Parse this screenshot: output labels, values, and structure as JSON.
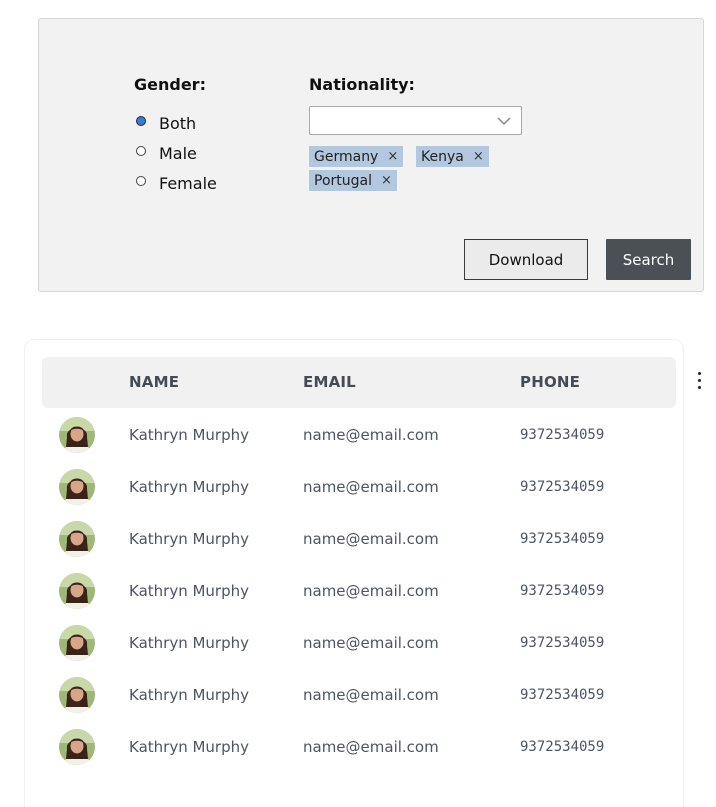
{
  "filters": {
    "gender": {
      "heading": "Gender:",
      "options": [
        {
          "label": "Both",
          "checked": true
        },
        {
          "label": "Male",
          "checked": false
        },
        {
          "label": "Female",
          "checked": false
        }
      ]
    },
    "nationality": {
      "heading": "Nationality:",
      "select_value": "",
      "tags": [
        "Germany",
        "Kenya",
        "Portugal"
      ],
      "tag_remove_glyph": "×"
    },
    "buttons": {
      "download_label": "Download",
      "search_label": "Search"
    }
  },
  "table": {
    "columns": [
      "NAME",
      "EMAIL",
      "PHONE"
    ],
    "rows": [
      {
        "name": "Kathryn Murphy",
        "email": "name@email.com",
        "phone": "9372534059"
      },
      {
        "name": "Kathryn Murphy",
        "email": "name@email.com",
        "phone": "9372534059"
      },
      {
        "name": "Kathryn Murphy",
        "email": "name@email.com",
        "phone": "9372534059"
      },
      {
        "name": "Kathryn Murphy",
        "email": "name@email.com",
        "phone": "9372534059"
      },
      {
        "name": "Kathryn Murphy",
        "email": "name@email.com",
        "phone": "9372534059"
      },
      {
        "name": "Kathryn Murphy",
        "email": "name@email.com",
        "phone": "9372534059"
      },
      {
        "name": "Kathryn Murphy",
        "email": "name@email.com",
        "phone": "9372534059"
      }
    ],
    "menu_icon": "kebab-menu-icon"
  },
  "colors": {
    "radio_selected": "#3b78d8",
    "tag_background": "#b3c8de",
    "search_button": "#4b4f56",
    "panel_background": "#f2f2f2"
  }
}
